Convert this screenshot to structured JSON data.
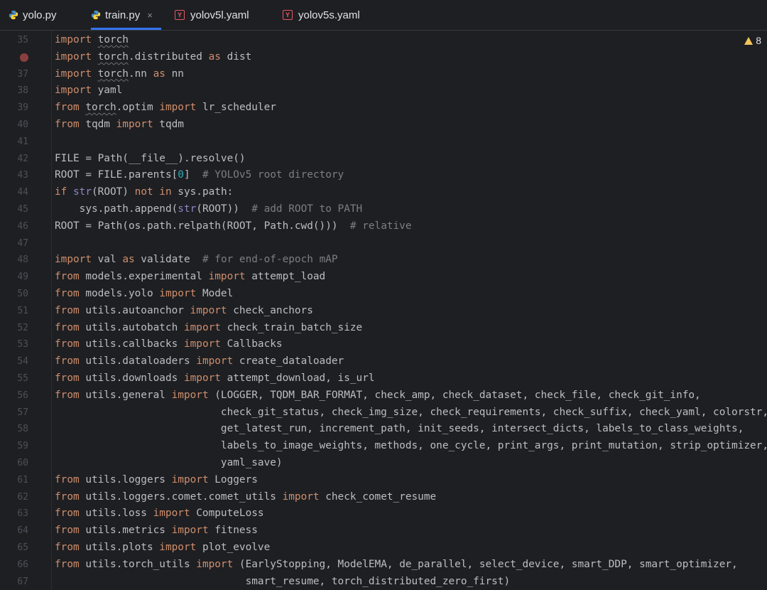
{
  "tabs": [
    {
      "label": "yolo.py",
      "icon": "python-icon"
    },
    {
      "label": "train.py",
      "icon": "python-icon",
      "active": true,
      "close": "×"
    },
    {
      "label": "yolov5l.yaml",
      "icon": "yaml-icon",
      "icon_letter": "Y"
    },
    {
      "label": "yolov5s.yaml",
      "icon": "yaml-icon",
      "icon_letter": "Y"
    }
  ],
  "warnings": {
    "count": "8",
    "icon": "warning-triangle-icon"
  },
  "colors": {
    "keyword": "#cf8e6d",
    "builtin": "#8888c6",
    "comment": "#7a7e85",
    "number": "#2aacb8",
    "active_tab": "#3574f0",
    "breakpoint": "#8a3f3f"
  },
  "gutter": {
    "breakpoint_line_index": 1
  },
  "lines": [
    {
      "n": "35",
      "tokens": [
        [
          "kw",
          "import"
        ],
        [
          "t",
          " "
        ],
        [
          "mod",
          "torch"
        ]
      ]
    },
    {
      "n": "36",
      "tokens": [
        [
          "kw",
          "import"
        ],
        [
          "t",
          " "
        ],
        [
          "mod",
          "torch"
        ],
        [
          "t",
          ".distributed "
        ],
        [
          "kw",
          "as"
        ],
        [
          "t",
          " dist"
        ]
      ]
    },
    {
      "n": "37",
      "tokens": [
        [
          "kw",
          "import"
        ],
        [
          "t",
          " "
        ],
        [
          "mod",
          "torch"
        ],
        [
          "t",
          ".nn "
        ],
        [
          "kw",
          "as"
        ],
        [
          "t",
          " nn"
        ]
      ]
    },
    {
      "n": "38",
      "tokens": [
        [
          "kw",
          "import"
        ],
        [
          "t",
          " yaml"
        ]
      ]
    },
    {
      "n": "39",
      "tokens": [
        [
          "kw",
          "from"
        ],
        [
          "t",
          " "
        ],
        [
          "mod",
          "torch"
        ],
        [
          "t",
          ".optim "
        ],
        [
          "kw",
          "import"
        ],
        [
          "t",
          " lr_scheduler"
        ]
      ]
    },
    {
      "n": "40",
      "tokens": [
        [
          "kw",
          "from"
        ],
        [
          "t",
          " tqdm "
        ],
        [
          "kw",
          "import"
        ],
        [
          "t",
          " tqdm"
        ]
      ]
    },
    {
      "n": "41",
      "tokens": []
    },
    {
      "n": "42",
      "tokens": [
        [
          "t",
          "FILE = Path(__file__).resolve()"
        ]
      ]
    },
    {
      "n": "43",
      "tokens": [
        [
          "t",
          "ROOT = FILE.parents["
        ],
        [
          "num",
          "0"
        ],
        [
          "t",
          "]  "
        ],
        [
          "cm",
          "# YOLOv5 root directory"
        ]
      ]
    },
    {
      "n": "44",
      "tokens": [
        [
          "kw",
          "if"
        ],
        [
          "t",
          " "
        ],
        [
          "bi",
          "str"
        ],
        [
          "t",
          "(ROOT) "
        ],
        [
          "kw",
          "not in"
        ],
        [
          "t",
          " sys.path:"
        ]
      ]
    },
    {
      "n": "45",
      "tokens": [
        [
          "t",
          "    sys.path.append("
        ],
        [
          "bi",
          "str"
        ],
        [
          "t",
          "(ROOT))  "
        ],
        [
          "cm",
          "# add ROOT to PATH"
        ]
      ]
    },
    {
      "n": "46",
      "tokens": [
        [
          "t",
          "ROOT = Path(os.path.relpath(ROOT, Path.cwd()))  "
        ],
        [
          "cm",
          "# relative"
        ]
      ]
    },
    {
      "n": "47",
      "tokens": []
    },
    {
      "n": "48",
      "tokens": [
        [
          "kw",
          "import"
        ],
        [
          "t",
          " val "
        ],
        [
          "kw",
          "as"
        ],
        [
          "t",
          " validate  "
        ],
        [
          "cm",
          "# for end-of-epoch mAP"
        ]
      ]
    },
    {
      "n": "49",
      "tokens": [
        [
          "kw",
          "from"
        ],
        [
          "t",
          " models.experimental "
        ],
        [
          "kw",
          "import"
        ],
        [
          "t",
          " attempt_load"
        ]
      ]
    },
    {
      "n": "50",
      "tokens": [
        [
          "kw",
          "from"
        ],
        [
          "t",
          " models.yolo "
        ],
        [
          "kw",
          "import"
        ],
        [
          "t",
          " Model"
        ]
      ]
    },
    {
      "n": "51",
      "tokens": [
        [
          "kw",
          "from"
        ],
        [
          "t",
          " utils.autoanchor "
        ],
        [
          "kw",
          "import"
        ],
        [
          "t",
          " check_anchors"
        ]
      ]
    },
    {
      "n": "52",
      "tokens": [
        [
          "kw",
          "from"
        ],
        [
          "t",
          " utils.autobatch "
        ],
        [
          "kw",
          "import"
        ],
        [
          "t",
          " check_train_batch_size"
        ]
      ]
    },
    {
      "n": "53",
      "tokens": [
        [
          "kw",
          "from"
        ],
        [
          "t",
          " utils.callbacks "
        ],
        [
          "kw",
          "import"
        ],
        [
          "t",
          " Callbacks"
        ]
      ]
    },
    {
      "n": "54",
      "tokens": [
        [
          "kw",
          "from"
        ],
        [
          "t",
          " utils.dataloaders "
        ],
        [
          "kw",
          "import"
        ],
        [
          "t",
          " create_dataloader"
        ]
      ]
    },
    {
      "n": "55",
      "tokens": [
        [
          "kw",
          "from"
        ],
        [
          "t",
          " utils.downloads "
        ],
        [
          "kw",
          "import"
        ],
        [
          "t",
          " attempt_download, is_url"
        ]
      ]
    },
    {
      "n": "56",
      "tokens": [
        [
          "kw",
          "from"
        ],
        [
          "t",
          " utils.general "
        ],
        [
          "kw",
          "import"
        ],
        [
          "t",
          " (LOGGER, TQDM_BAR_FORMAT, check_amp, check_dataset, check_file, check_git_info,"
        ]
      ]
    },
    {
      "n": "57",
      "tokens": [
        [
          "t",
          "                           check_git_status, check_img_size, check_requirements, check_suffix, check_yaml, colorstr,"
        ]
      ]
    },
    {
      "n": "58",
      "tokens": [
        [
          "t",
          "                           get_latest_run, increment_path, init_seeds, intersect_dicts, labels_to_class_weights,"
        ]
      ]
    },
    {
      "n": "59",
      "tokens": [
        [
          "t",
          "                           labels_to_image_weights, methods, one_cycle, print_args, print_mutation, strip_optimizer,"
        ]
      ]
    },
    {
      "n": "60",
      "tokens": [
        [
          "t",
          "                           yaml_save)"
        ]
      ]
    },
    {
      "n": "61",
      "tokens": [
        [
          "kw",
          "from"
        ],
        [
          "t",
          " utils.loggers "
        ],
        [
          "kw",
          "import"
        ],
        [
          "t",
          " Loggers"
        ]
      ]
    },
    {
      "n": "62",
      "tokens": [
        [
          "kw",
          "from"
        ],
        [
          "t",
          " utils.loggers.comet.comet_utils "
        ],
        [
          "kw",
          "import"
        ],
        [
          "t",
          " check_comet_resume"
        ]
      ]
    },
    {
      "n": "63",
      "tokens": [
        [
          "kw",
          "from"
        ],
        [
          "t",
          " utils.loss "
        ],
        [
          "kw",
          "import"
        ],
        [
          "t",
          " ComputeLoss"
        ]
      ]
    },
    {
      "n": "64",
      "tokens": [
        [
          "kw",
          "from"
        ],
        [
          "t",
          " utils.metrics "
        ],
        [
          "kw",
          "import"
        ],
        [
          "t",
          " fitness"
        ]
      ]
    },
    {
      "n": "65",
      "tokens": [
        [
          "kw",
          "from"
        ],
        [
          "t",
          " utils.plots "
        ],
        [
          "kw",
          "import"
        ],
        [
          "t",
          " plot_evolve"
        ]
      ]
    },
    {
      "n": "66",
      "tokens": [
        [
          "kw",
          "from"
        ],
        [
          "t",
          " utils.torch_utils "
        ],
        [
          "kw",
          "import"
        ],
        [
          "t",
          " (EarlyStopping, ModelEMA, de_parallel, select_device, smart_DDP, smart_optimizer,"
        ]
      ]
    },
    {
      "n": "67",
      "tokens": [
        [
          "t",
          "                               smart_resume, torch_distributed_zero_first)"
        ]
      ]
    }
  ]
}
